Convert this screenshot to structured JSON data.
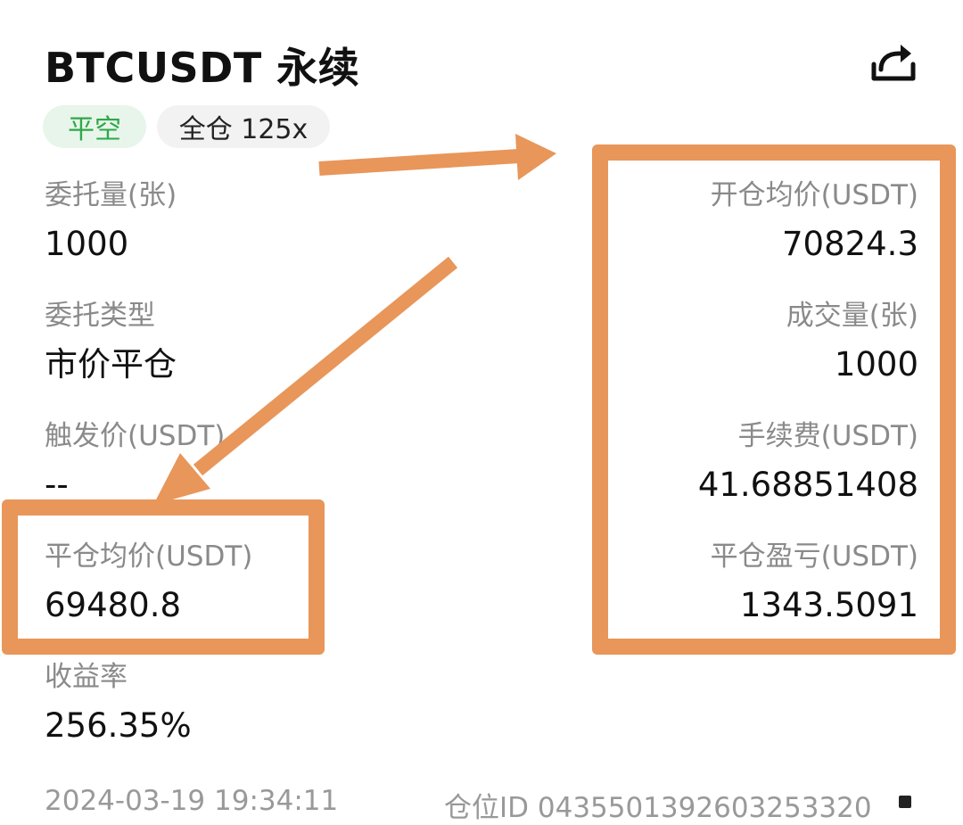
{
  "header": {
    "title": "BTCUSDT 永续",
    "share_icon": "share-icon"
  },
  "tags": {
    "side": "平空",
    "margin": "全仓 125x"
  },
  "left_fields": [
    {
      "label": "委托量(张)",
      "value": "1000"
    },
    {
      "label": "委托类型",
      "value": "市价平仓"
    },
    {
      "label": "触发价(USDT)",
      "value": "--"
    },
    {
      "label": "平仓均价(USDT)",
      "value": "69480.8"
    },
    {
      "label": "收益率",
      "value": "256.35%"
    }
  ],
  "right_fields": [
    {
      "label": "开仓均价(USDT)",
      "value": "70824.3"
    },
    {
      "label": "成交量(张)",
      "value": "1000"
    },
    {
      "label": "手续费(USDT)",
      "value": "41.68851408"
    },
    {
      "label": "平仓盈亏(USDT)",
      "value": "1343.5091"
    }
  ],
  "footer": {
    "time": "2024-03-19 19:34:11",
    "position_id": "仓位ID 0435501392603253320"
  },
  "colors": {
    "highlight": "#e8965a",
    "close_short_green": "#2ea84a",
    "label_gray": "#8a8a8a"
  }
}
